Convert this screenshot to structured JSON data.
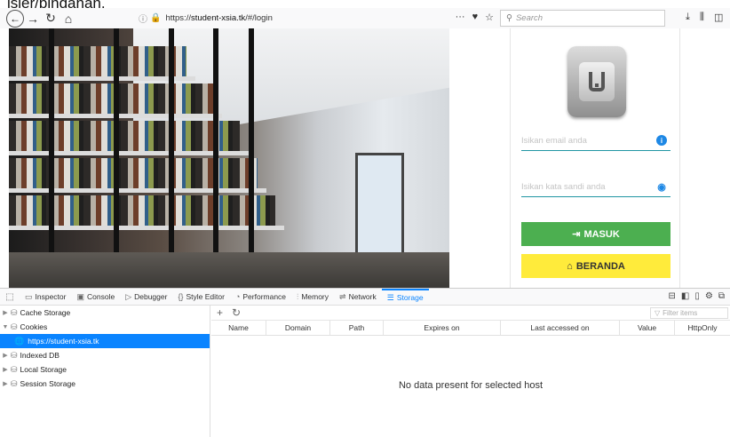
{
  "caption": "isier/pindahan.",
  "browser": {
    "url_prefix": "https://",
    "url_host": "student-xsia.tk",
    "url_path": "/#/login",
    "search_placeholder": "Search"
  },
  "login": {
    "email_placeholder": "Isikan email anda",
    "password_placeholder": "Isikan kata sandi anda",
    "masuk_label": "MASUK",
    "beranda_label": "BERANDA"
  },
  "devtools": {
    "tabs": [
      {
        "label": "Inspector",
        "icon": "inspector-icon"
      },
      {
        "label": "Console",
        "icon": "console-icon"
      },
      {
        "label": "Debugger",
        "icon": "debugger-icon"
      },
      {
        "label": "Style Editor",
        "icon": "style-editor-icon"
      },
      {
        "label": "Performance",
        "icon": "performance-icon"
      },
      {
        "label": "Memory",
        "icon": "memory-icon"
      },
      {
        "label": "Network",
        "icon": "network-icon"
      },
      {
        "label": "Storage",
        "icon": "storage-icon",
        "active": true
      }
    ],
    "tree": [
      {
        "label": "Cache Storage",
        "expanded": false
      },
      {
        "label": "Cookies",
        "expanded": true
      },
      {
        "label": "https://student-xsia.tk",
        "selected": true,
        "child": true
      },
      {
        "label": "Indexed DB",
        "expanded": false
      },
      {
        "label": "Local Storage",
        "expanded": false
      },
      {
        "label": "Session Storage",
        "expanded": false
      }
    ],
    "filter_placeholder": "Filter items",
    "columns": [
      "Name",
      "Domain",
      "Path",
      "Expires on",
      "Last accessed on",
      "Value",
      "HttpOnly"
    ],
    "empty_message": "No data present for selected host"
  }
}
